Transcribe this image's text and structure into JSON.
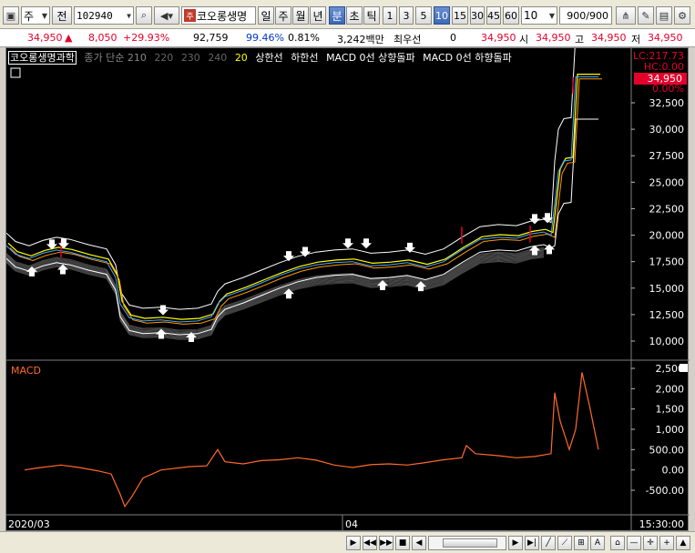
{
  "toolbar": {
    "market": "주",
    "prefix": "전",
    "code": "102940",
    "ju_badge": "주",
    "stock_name": "코오롱생명",
    "periods": [
      "일",
      "주",
      "월",
      "년",
      "분",
      "초",
      "틱"
    ],
    "selected_period": "분",
    "intervals": [
      "1",
      "3",
      "5",
      "10",
      "15",
      "30",
      "45",
      "60"
    ],
    "selected_interval": "10",
    "interval_value": "10",
    "count": "900",
    "count_total": "/900"
  },
  "quote": {
    "price": "34,950",
    "change": "8,050",
    "change_pct": "+29.93%",
    "volume": "92,759",
    "vol_ratio": "99.46%",
    "turnover": "0.81%",
    "amount": "3,242백만",
    "pref_label": "최우선",
    "pref_value": "0",
    "last": "34,950",
    "open_label": "시",
    "open": "34,950",
    "high_label": "고",
    "high": "34,950",
    "low_label": "저",
    "low": "34,950"
  },
  "legend": {
    "name": "코오롱생명과학",
    "ma": "종가 단순 210",
    "ma2": "220",
    "ma3": "230",
    "ma4": "240",
    "ma5": "20",
    "upper": "상한선",
    "lower": "하한선",
    "macd_up": "MACD 0선 상향돌파",
    "macd_down": "MACD 0선 하향돌파"
  },
  "price_axis": {
    "lc": "LC:217.73",
    "hc": "HC:0.00",
    "last_tag": "34,950",
    "pct": "0.00%",
    "ticks": [
      "32,500",
      "30,000",
      "27,500",
      "25,000",
      "22,500",
      "20,000",
      "17,500",
      "15,000",
      "12,500",
      "10,000"
    ]
  },
  "macd": {
    "title": "MACD",
    "ticks": [
      "2,500",
      "2,000",
      "1,500",
      "1,000",
      "500.00",
      "0.00",
      "-500.00"
    ]
  },
  "time_axis": {
    "start": "2020/03",
    "mid": "04",
    "end": "15:30:00"
  },
  "colors": {
    "up": "#e4002b",
    "down": "#0037c8",
    "macd": "#ff6a2a",
    "selected": "#3c68b8"
  }
}
